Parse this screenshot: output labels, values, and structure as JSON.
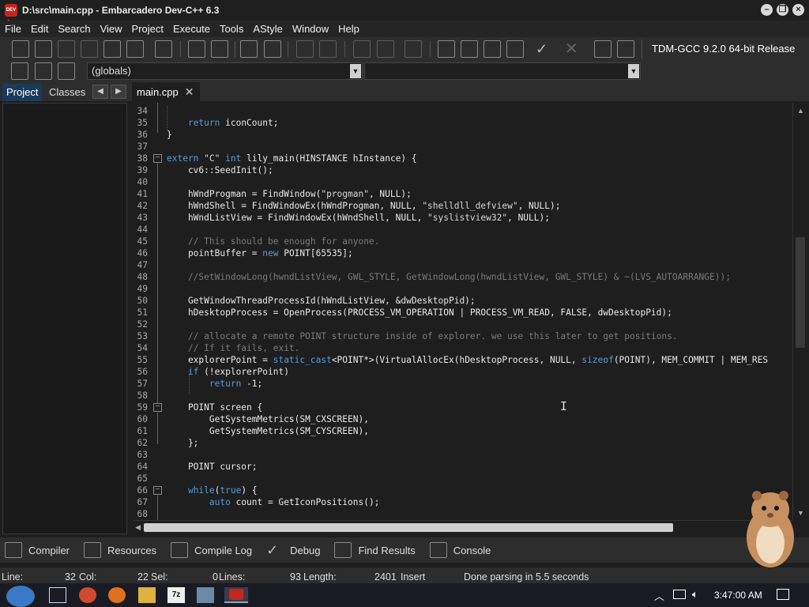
{
  "window": {
    "title": "D:\\src\\main.cpp - Embarcadero Dev-C++ 6.3",
    "app_icon_text": "DEV C++"
  },
  "menu": [
    "File",
    "Edit",
    "Search",
    "View",
    "Project",
    "Execute",
    "Tools",
    "AStyle",
    "Window",
    "Help"
  ],
  "toolbar": {
    "compiler": "TDM-GCC 9.2.0 64-bit Release",
    "scope_combo": "(globals)",
    "function_combo": ""
  },
  "left_panel": {
    "tabs": [
      "Project",
      "Classes"
    ],
    "active_tab": "Project"
  },
  "editor": {
    "tab_label": "main.cpp",
    "lines": [
      {
        "n": "34",
        "html": ""
      },
      {
        "n": "35",
        "html": "    <span class='kw'>return</span> iconCount;"
      },
      {
        "n": "36",
        "html": "}"
      },
      {
        "n": "37",
        "html": ""
      },
      {
        "n": "38",
        "html": "<span class='kw'>extern</span> <span class='str'>\"C\"</span> <span class='kw'>int</span> lily_main(HINSTANCE hInstance) {"
      },
      {
        "n": "39",
        "html": "    cv6::SeedInit();"
      },
      {
        "n": "40",
        "html": ""
      },
      {
        "n": "41",
        "html": "    hWndProgman = FindWindow(<span class='str'>\"progman\"</span>, NULL);"
      },
      {
        "n": "42",
        "html": "    hWndShell = FindWindowEx(hWndProgman, NULL, <span class='str'>\"shelldll_defview\"</span>, NULL);"
      },
      {
        "n": "43",
        "html": "    hWndListView = FindWindowEx(hWndShell, NULL, <span class='str'>\"syslistview32\"</span>, NULL);"
      },
      {
        "n": "44",
        "html": ""
      },
      {
        "n": "45",
        "html": "    <span class='cm'>// This should be enough for anyone.</span>"
      },
      {
        "n": "46",
        "html": "    pointBuffer = <span class='kw'>new</span> POINT[65535];"
      },
      {
        "n": "47",
        "html": ""
      },
      {
        "n": "48",
        "html": "    <span class='cm'>//SetWindowLong(hwndListView, GWL_STYLE, GetWindowLong(hwndListView, GWL_STYLE) &amp; ~(LVS_AUTOARRANGE));</span>"
      },
      {
        "n": "49",
        "html": ""
      },
      {
        "n": "50",
        "html": "    GetWindowThreadProcessId(hWndListView, &amp;dwDesktopPid);"
      },
      {
        "n": "51",
        "html": "    hDesktopProcess = OpenProcess(PROCESS_VM_OPERATION | PROCESS_VM_READ, FALSE, dwDesktopPid);"
      },
      {
        "n": "52",
        "html": ""
      },
      {
        "n": "53",
        "html": "    <span class='cm'>// allocate a remote POINT structure inside of explorer. we use this later to get positions.</span>"
      },
      {
        "n": "54",
        "html": "    <span class='cm'>// If it fails, exit.</span>"
      },
      {
        "n": "55",
        "html": "    explorerPoint = <span class='kw'>static_cast</span>&lt;POINT*&gt;(VirtualAllocEx(hDesktopProcess, NULL, <span class='kw'>sizeof</span>(POINT), MEM_COMMIT | MEM_RES"
      },
      {
        "n": "56",
        "html": "    <span class='kw'>if</span> (!explorerPoint)"
      },
      {
        "n": "57",
        "html": "        <span class='kw'>return</span> -1;"
      },
      {
        "n": "58",
        "html": ""
      },
      {
        "n": "59",
        "html": "    POINT screen {"
      },
      {
        "n": "60",
        "html": "        GetSystemMetrics(SM_CXSCREEN),"
      },
      {
        "n": "61",
        "html": "        GetSystemMetrics(SM_CYSCREEN),"
      },
      {
        "n": "62",
        "html": "    };"
      },
      {
        "n": "63",
        "html": ""
      },
      {
        "n": "64",
        "html": "    POINT cursor;"
      },
      {
        "n": "65",
        "html": ""
      },
      {
        "n": "66",
        "html": "    <span class='kw'>while</span>(<span class='kw'>true</span>) {"
      },
      {
        "n": "67",
        "html": "        <span class='kw'>auto</span> count = GetIconPositions();"
      },
      {
        "n": "68",
        "html": ""
      }
    ]
  },
  "bottom_tabs": [
    "Compiler",
    "Resources",
    "Compile Log",
    "Debug",
    "Find Results",
    "Console"
  ],
  "status": {
    "line_label": "Line:",
    "line_value": "32",
    "col_label": "Col:",
    "col_value": "22",
    "sel_label": "Sel:",
    "sel_value": "0",
    "lines_label": "Lines:",
    "lines_value": "93",
    "length_label": "Length:",
    "length_value": "2401",
    "mode": "Insert",
    "message": "Done parsing in 5.5 seconds"
  },
  "taskbar": {
    "clock": "3:47:00 AM"
  }
}
